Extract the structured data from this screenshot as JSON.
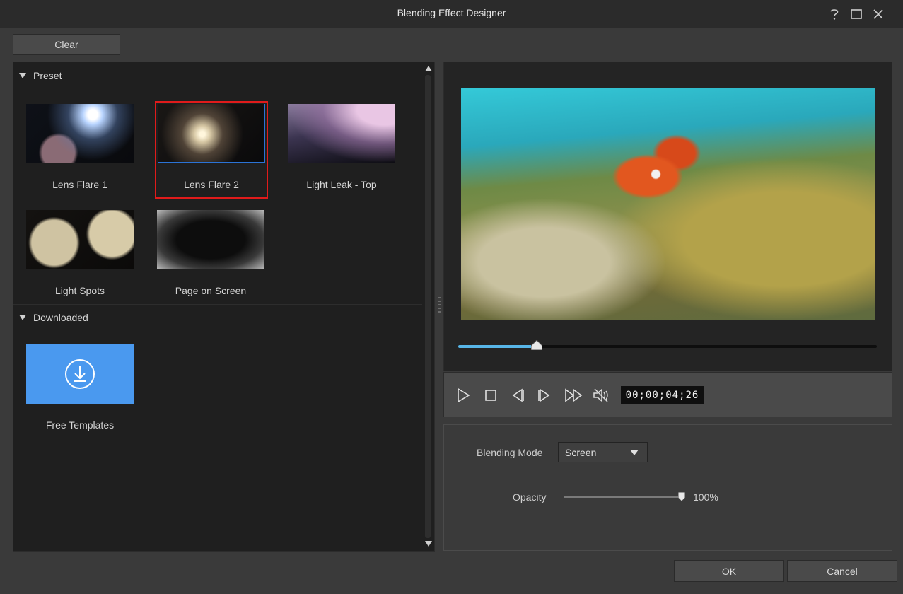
{
  "window": {
    "title": "Blending Effect Designer",
    "help_icon": "question-mark-icon",
    "maximize_icon": "maximize-icon",
    "close_icon": "close-icon"
  },
  "toolbar": {
    "clear_label": "Clear"
  },
  "library": {
    "sections": [
      {
        "name": "Preset",
        "items": [
          {
            "label": "Lens Flare 1",
            "selected": false
          },
          {
            "label": "Lens Flare 2",
            "selected": true
          },
          {
            "label": "Light Leak - Top",
            "selected": false
          },
          {
            "label": "Light Spots",
            "selected": false
          },
          {
            "label": "Page on Screen",
            "selected": false
          }
        ]
      },
      {
        "name": "Downloaded",
        "items": [
          {
            "label": "Free Templates",
            "icon": "download-icon"
          }
        ]
      }
    ]
  },
  "preview": {
    "playhead_fraction": 0.188,
    "timecode": "00;00;04;26",
    "controls": [
      "play-icon",
      "stop-icon",
      "previous-frame-icon",
      "next-frame-icon",
      "fast-forward-icon",
      "mute-icon"
    ]
  },
  "settings": {
    "blending_mode_label": "Blending Mode",
    "blending_mode_value": "Screen",
    "opacity_label": "Opacity",
    "opacity_value": "100%",
    "opacity_fraction": 1.0
  },
  "footer": {
    "ok_label": "OK",
    "cancel_label": "Cancel"
  },
  "colors": {
    "accent": "#58b6e8",
    "selection_border": "#e01b1b",
    "focus_border": "#2b73d6",
    "download_tile": "#4a99ef"
  }
}
